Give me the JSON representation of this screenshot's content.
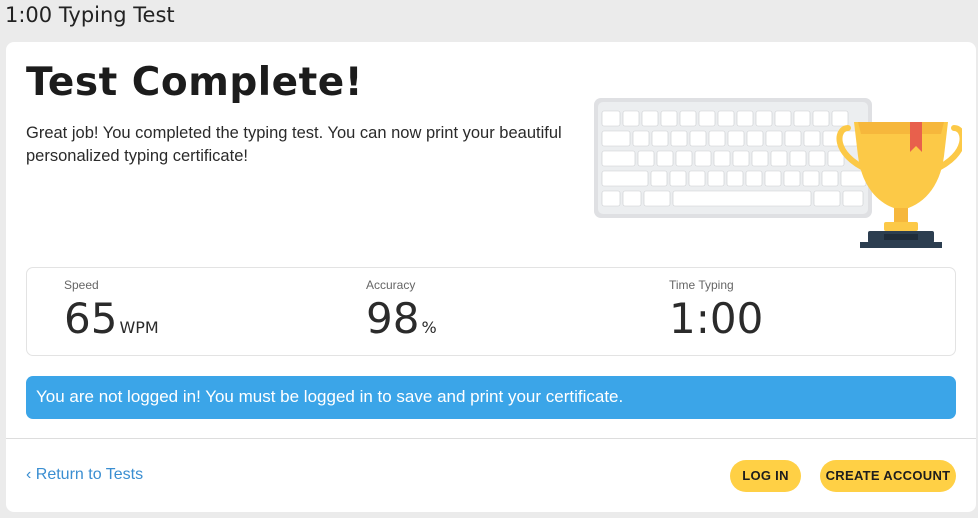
{
  "window": {
    "title": "1:00 Typing Test"
  },
  "main": {
    "heading": "Test Complete!",
    "intro": "Great job! You completed the typing test. You can now print your beautiful personalized typing certificate!"
  },
  "stats": {
    "speed": {
      "label": "Speed",
      "value": "65",
      "unit": "WPM"
    },
    "accuracy": {
      "label": "Accuracy",
      "value": "98",
      "unit": "%"
    },
    "time": {
      "label": "Time Typing",
      "value": "1:00"
    }
  },
  "alert": {
    "text": "You are not logged in! You must be logged in to save and print your certificate."
  },
  "footer": {
    "return_link": "‹ Return to Tests",
    "login_label": "LOG IN",
    "create_label": "CREATE ACCOUNT"
  },
  "illustration": {
    "icons": [
      "keyboard-icon",
      "trophy-icon"
    ],
    "colors": {
      "trophy": "#fcc947",
      "trophy_ribbon": "#e8604c",
      "base": "#2c3e50",
      "keyboard": "#dfe0e3"
    }
  },
  "colors": {
    "accent_blue": "#3ba5e8",
    "button_yellow": "#ffd045",
    "link_blue": "#3a8ed1"
  }
}
